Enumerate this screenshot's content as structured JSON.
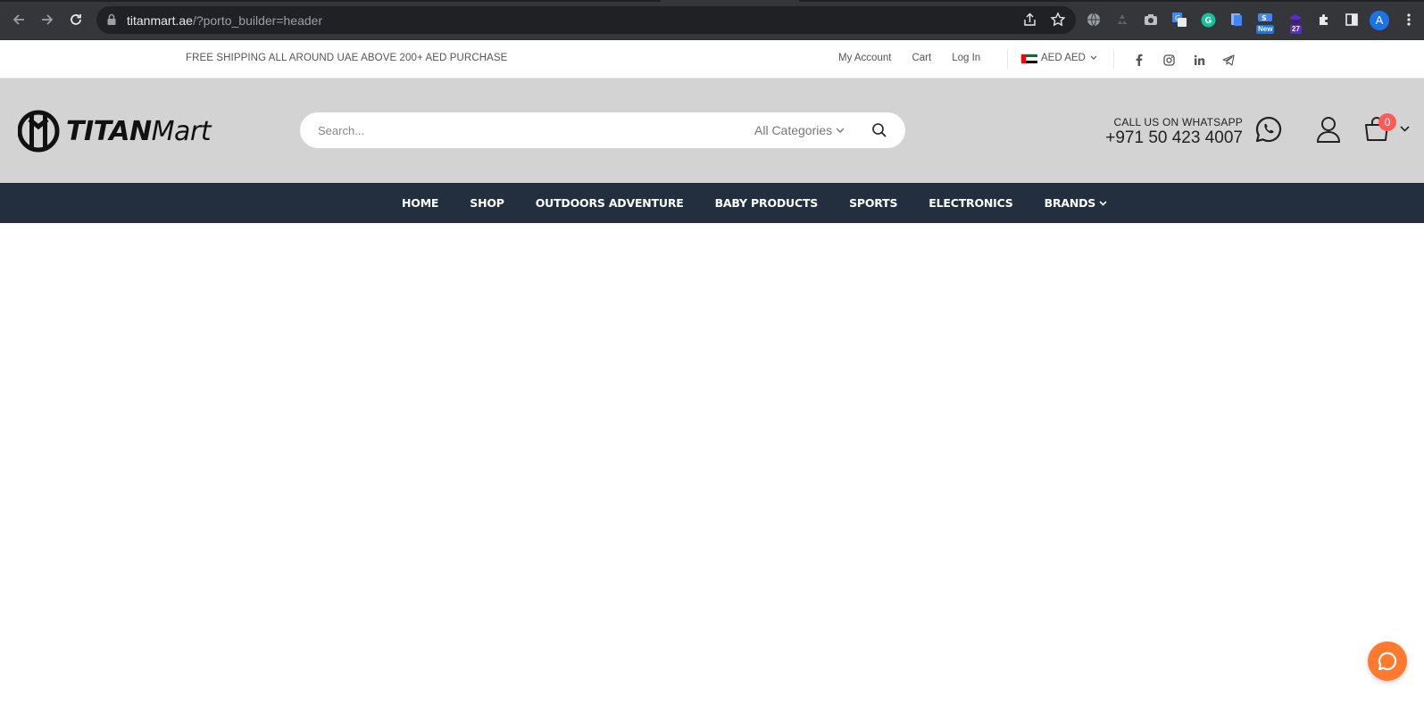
{
  "browser": {
    "url_host": "titanmart.ae",
    "url_path": "/?porto_builder=header",
    "profile_initial": "A",
    "extensions": [
      {
        "name": "globe-icon"
      },
      {
        "name": "recycle-icon"
      },
      {
        "name": "camera-icon"
      },
      {
        "name": "translate-icon"
      },
      {
        "name": "grammarly-icon"
      },
      {
        "name": "docs-icon"
      },
      {
        "name": "new-extension-icon",
        "badge": "New"
      },
      {
        "name": "hat-extension-icon",
        "badge": "27"
      },
      {
        "name": "puzzle-icon"
      },
      {
        "name": "sidepanel-icon"
      }
    ]
  },
  "topbar": {
    "shipping_text": "FREE SHIPPING ALL AROUND UAE ABOVE 200+ AED PURCHASE",
    "links": [
      "My Account",
      "Cart",
      "Log In"
    ],
    "currency": "AED AED"
  },
  "header": {
    "logo_bold": "TITAN",
    "logo_light": "Mart",
    "search_placeholder": "Search...",
    "category_label": "All Categories",
    "whatsapp_label": "CALL US ON WHATSAPP",
    "whatsapp_phone": "+971 50 423 4007",
    "cart_count": "0"
  },
  "nav": {
    "items": [
      "HOME",
      "SHOP",
      "OUTDOORS ADVENTURE",
      "BABY PRODUCTS",
      "SPORTS",
      "ELECTRONICS",
      "BRANDS"
    ]
  },
  "colors": {
    "chrome_bg": "#35363a",
    "header_bg": "#d3d3d3",
    "nav_bg": "#232f3e",
    "cart_badge": "#ff5b5b",
    "chat_button": "#ff7a2f"
  }
}
